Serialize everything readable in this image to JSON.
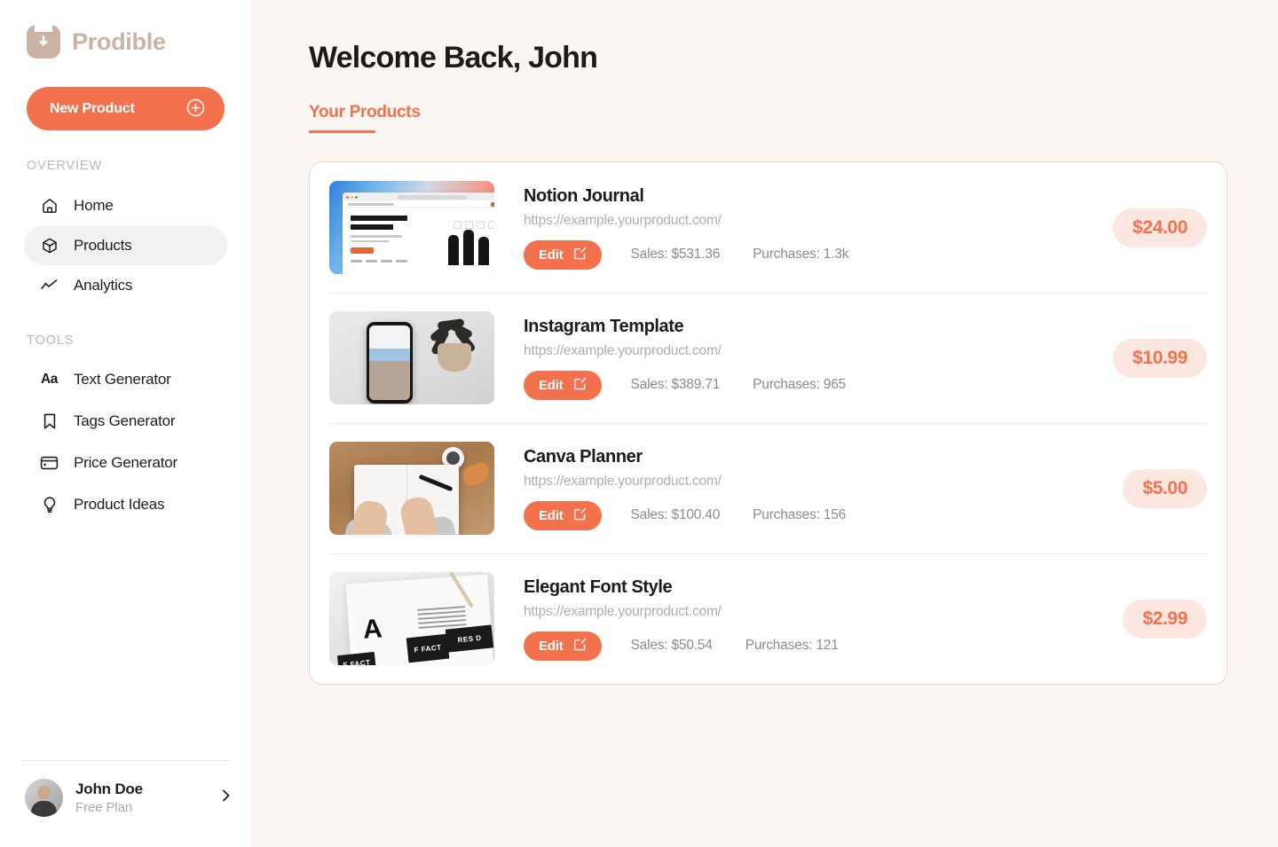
{
  "brand": {
    "name": "Prodible",
    "logo_icon": "download-box-icon",
    "color": "#CBB2A4"
  },
  "accent": {
    "orange": "#F3714C",
    "orange_soft": "#FBE7E0",
    "page_bg": "#FBF6F1"
  },
  "sidebar": {
    "new_product_label": "New Product",
    "new_product_icon": "plus-circle-icon",
    "sections": [
      {
        "title": "OVERVIEW",
        "items": [
          {
            "label": "Home",
            "icon": "home-icon",
            "active": false
          },
          {
            "label": "Products",
            "icon": "cube-icon",
            "active": true
          },
          {
            "label": "Analytics",
            "icon": "trend-line-icon",
            "active": false
          }
        ]
      },
      {
        "title": "TOOLS",
        "items": [
          {
            "label": "Text Generator",
            "icon": "text-aa-icon",
            "active": false
          },
          {
            "label": "Tags Generator",
            "icon": "bookmark-icon",
            "active": false
          },
          {
            "label": "Price Generator",
            "icon": "credit-card-icon",
            "active": false
          },
          {
            "label": "Product Ideas",
            "icon": "lightbulb-icon",
            "active": false
          }
        ]
      }
    ],
    "profile": {
      "name": "John Doe",
      "plan": "Free Plan",
      "avatar_icon": "user-avatar-photo",
      "chevron_icon": "chevron-right-icon"
    }
  },
  "main": {
    "page_title": "Welcome Back, John",
    "tabs": [
      {
        "label": "Your Products",
        "active": true
      }
    ],
    "products": [
      {
        "name": "Notion Journal",
        "url": "https://example.yourproduct.com/",
        "edit_label": "Edit",
        "edit_icon": "edit-pencil-square-icon",
        "sales": "Sales: $531.36",
        "purchases": "Purchases: 1.3k",
        "price": "$24.00",
        "thumb": "notion-website-screenshot"
      },
      {
        "name": "Instagram Template",
        "url": "https://example.yourproduct.com/",
        "edit_label": "Edit",
        "edit_icon": "edit-pencil-square-icon",
        "sales": "Sales: $389.71",
        "purchases": "Purchases: 965",
        "price": "$10.99",
        "thumb": "phone-with-plant-photo"
      },
      {
        "name": "Canva Planner",
        "url": "https://example.yourproduct.com/",
        "edit_label": "Edit",
        "edit_icon": "edit-pencil-square-icon",
        "sales": "Sales: $100.40",
        "purchases": "Purchases: 156",
        "price": "$5.00",
        "thumb": "hands-writing-notebook-photo"
      },
      {
        "name": "Elegant Font Style",
        "url": "https://example.yourproduct.com/",
        "edit_label": "Edit",
        "edit_icon": "edit-pencil-square-icon",
        "sales": "Sales: $50.54",
        "purchases": "Purchases: 121",
        "price": "$2.99",
        "thumb": "typography-book-photo"
      }
    ]
  },
  "thumb_text": {
    "fact_block": "F FACT",
    "res_block": "RES D"
  }
}
